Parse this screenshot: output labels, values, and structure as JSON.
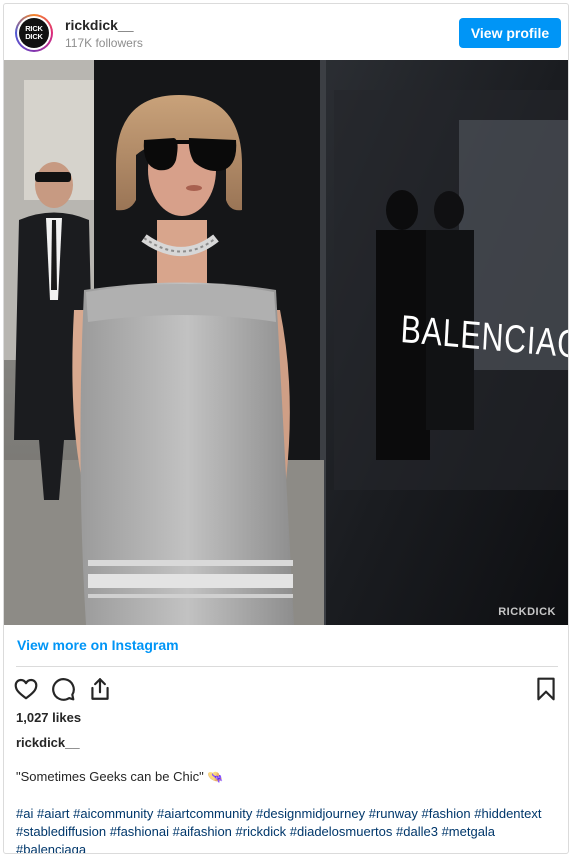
{
  "header": {
    "avatar_line1": "RICK",
    "avatar_line2": "DICK",
    "username": "rickdick__",
    "followers": "117K followers",
    "view_profile_label": "View profile"
  },
  "photo": {
    "sign_text": "BALENCIAGA",
    "watermark": "RICKDICK"
  },
  "more_link": "View more on Instagram",
  "likes": "1,027 likes",
  "caption": {
    "username": "rickdick__",
    "text": "\"Sometimes Geeks can be Chic\" 👒"
  },
  "hashtags": [
    "#ai",
    "#aiart",
    "#aicommunity",
    "#aiartcommunity",
    "#designmidjourney",
    "#runway",
    "#fashion",
    "#hiddentext",
    "#stablediffusion",
    "#fashionai",
    "#aifashion",
    "#rickdick",
    "#diadelosmuertos",
    "#dalle3",
    "#metgala",
    "#balenciaga"
  ],
  "icons": {
    "like": "heart-icon",
    "comment": "comment-icon",
    "share": "share-icon",
    "save": "bookmark-icon"
  },
  "colors": {
    "accent": "#0095f6",
    "hashtag": "#00376b",
    "text": "#262626",
    "muted": "#8e8e8e"
  }
}
